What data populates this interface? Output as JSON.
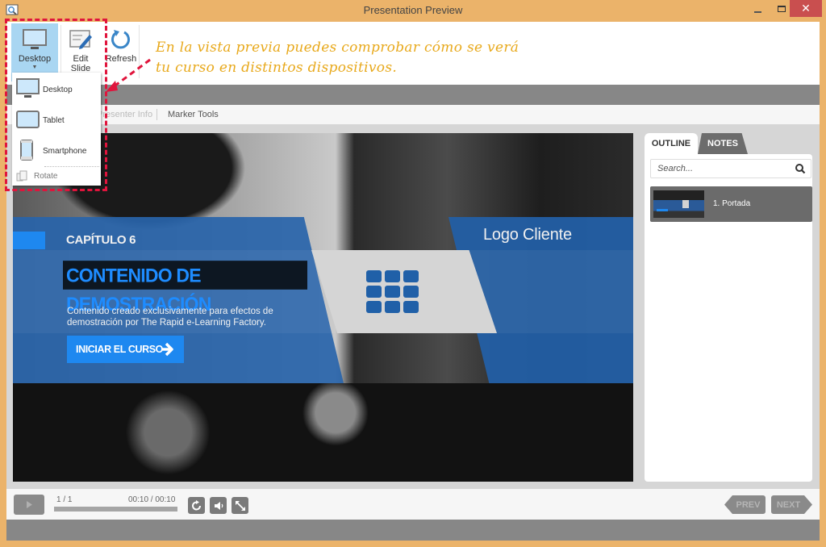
{
  "window": {
    "title": "Presentation Preview",
    "controls": {
      "minimize": "_",
      "maximize": "□",
      "close": "✕"
    }
  },
  "ribbon": {
    "device_button": {
      "label": "Desktop",
      "icon": "monitor-icon"
    },
    "edit_slide": {
      "label_line1": "Edit",
      "label_line2": "Slide",
      "icon": "edit-slide-icon"
    },
    "refresh": {
      "label": "Refresh",
      "icon": "refresh-icon"
    }
  },
  "device_menu": {
    "items": [
      {
        "label": "Desktop",
        "icon": "monitor-icon"
      },
      {
        "label": "Tablet",
        "icon": "tablet-icon"
      },
      {
        "label": "Smartphone",
        "icon": "smartphone-icon"
      }
    ],
    "rotate": {
      "label": "Rotate",
      "icon": "rotate-icon"
    }
  },
  "annotation": {
    "line1": "En la vista previa puedes comprobar cómo se verá",
    "line2": "tu curso en distintos dispositivos.",
    "color": "#e8a91c"
  },
  "subtoolbar": {
    "presenter_info": "Presenter Info",
    "marker_tools": "Marker Tools"
  },
  "slide": {
    "chapter": "CAPÍTULO 6",
    "title": "CONTENIDO DE DEMOSTRACIÓN",
    "description": "Contenido creado exclusivamente para efectos de demostración por The Rapid e-Learning Factory.",
    "start_button": "INICIAR EL CURSO",
    "logo": "Logo Cliente",
    "accent_color": "#1e88f0",
    "band_color": "#2864aa"
  },
  "sidebar": {
    "tabs": [
      {
        "label": "OUTLINE",
        "active": true
      },
      {
        "label": "NOTES",
        "active": false
      }
    ],
    "search_placeholder": "Search...",
    "outline_items": [
      {
        "label": "1. Portada",
        "selected": true
      }
    ]
  },
  "player": {
    "slide_count": "1 / 1",
    "time": "00:10 / 00:10",
    "progress_percent": 100,
    "prev_label": "PREV",
    "next_label": "NEXT"
  },
  "highlight_color": "#e0143c"
}
